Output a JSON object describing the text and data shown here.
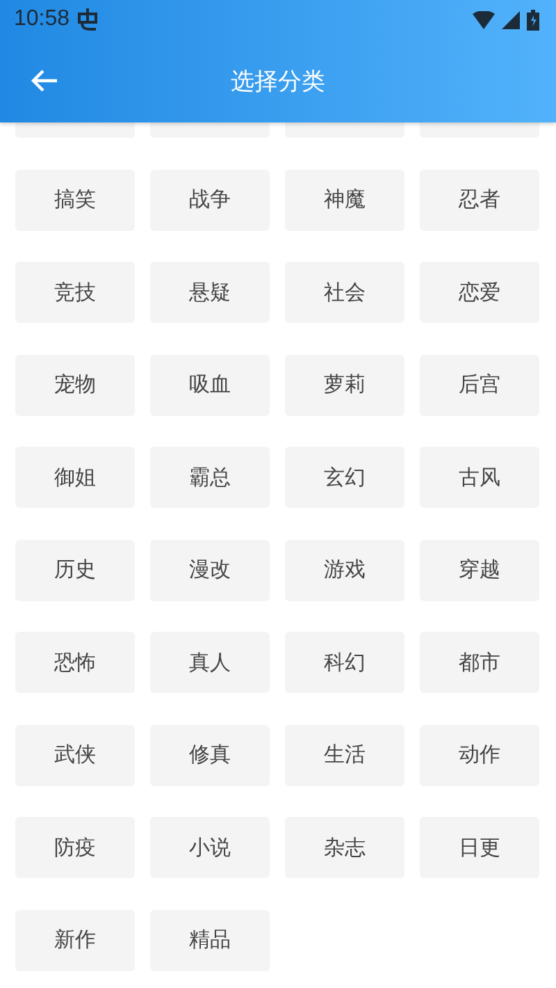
{
  "status_bar": {
    "time": "10:58"
  },
  "toolbar": {
    "title": "选择分类"
  },
  "categories": [
    "搞笑",
    "战争",
    "神魔",
    "忍者",
    "竞技",
    "悬疑",
    "社会",
    "恋爱",
    "宠物",
    "吸血",
    "萝莉",
    "后宫",
    "御姐",
    "霸总",
    "玄幻",
    "古风",
    "历史",
    "漫改",
    "游戏",
    "穿越",
    "恐怖",
    "真人",
    "科幻",
    "都市",
    "武侠",
    "修真",
    "生活",
    "动作",
    "防疫",
    "小说",
    "杂志",
    "日更",
    "新作",
    "精品"
  ]
}
